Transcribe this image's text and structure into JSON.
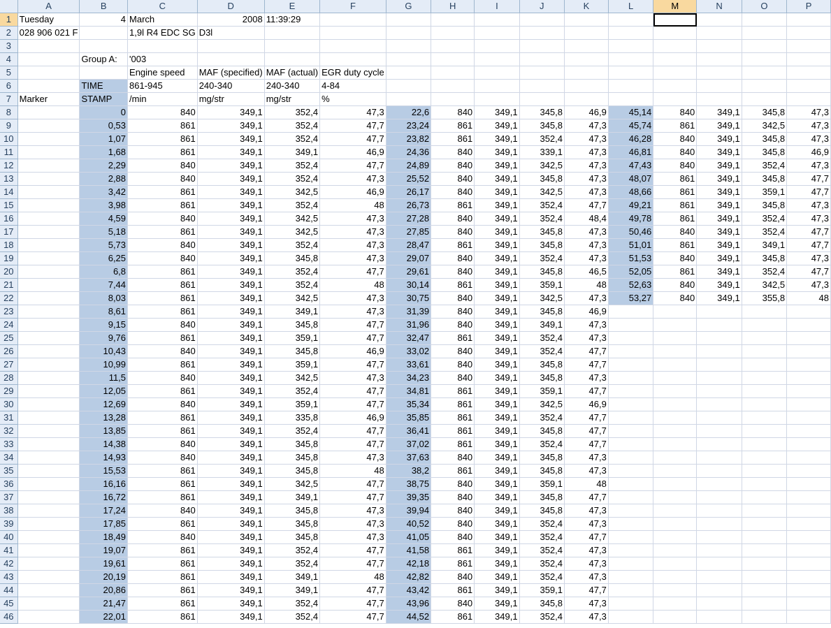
{
  "columns": [
    "A",
    "B",
    "C",
    "D",
    "E",
    "F",
    "G",
    "H",
    "I",
    "J",
    "K",
    "L",
    "M",
    "N",
    "O",
    "P"
  ],
  "selected_column": "M",
  "selected_row": 1,
  "header_rows": [
    [
      "Tuesday",
      "4",
      "March",
      "2008",
      "11:39:29",
      "",
      "",
      "",
      "",
      "",
      "",
      "",
      "",
      "",
      "",
      ""
    ],
    [
      "028 906 021 F",
      "",
      "1,9l R4 EDC SG",
      "D3l",
      "",
      "",
      "",
      "",
      "",
      "",
      "",
      "",
      "",
      "",
      "",
      ""
    ],
    [
      "",
      "",
      "",
      "",
      "",
      "",
      "",
      "",
      "",
      "",
      "",
      "",
      "",
      "",
      "",
      ""
    ],
    [
      "",
      "Group A:",
      "'003",
      "",
      "",
      "",
      "",
      "",
      "",
      "",
      "",
      "",
      "",
      "",
      "",
      ""
    ],
    [
      "",
      "",
      "Engine speed",
      "MAF (specified)",
      "MAF (actual)",
      "EGR duty cycle",
      "",
      "",
      "",
      "",
      "",
      "",
      "",
      "",
      "",
      ""
    ],
    [
      "",
      "TIME",
      "861-945",
      "240-340",
      "240-340",
      "4-84",
      "",
      "",
      "",
      "",
      "",
      "",
      "",
      "",
      "",
      ""
    ],
    [
      "Marker",
      "STAMP",
      " /min",
      "mg/str",
      "mg/str",
      "%",
      "",
      "",
      "",
      "",
      "",
      "",
      "",
      "",
      "",
      ""
    ]
  ],
  "data_rows": [
    [
      "0",
      "840",
      "349,1",
      "352,4",
      "47,3",
      "22,6",
      "840",
      "349,1",
      "345,8",
      "46,9",
      "45,14",
      "840",
      "349,1",
      "345,8",
      "47,3"
    ],
    [
      "0,53",
      "861",
      "349,1",
      "352,4",
      "47,7",
      "23,24",
      "861",
      "349,1",
      "345,8",
      "47,3",
      "45,74",
      "861",
      "349,1",
      "342,5",
      "47,3"
    ],
    [
      "1,07",
      "861",
      "349,1",
      "352,4",
      "47,7",
      "23,82",
      "861",
      "349,1",
      "352,4",
      "47,3",
      "46,28",
      "840",
      "349,1",
      "345,8",
      "47,3"
    ],
    [
      "1,68",
      "861",
      "349,1",
      "349,1",
      "46,9",
      "24,36",
      "840",
      "349,1",
      "339,1",
      "47,3",
      "46,81",
      "840",
      "349,1",
      "345,8",
      "46,9"
    ],
    [
      "2,29",
      "840",
      "349,1",
      "352,4",
      "47,7",
      "24,89",
      "840",
      "349,1",
      "342,5",
      "47,3",
      "47,43",
      "840",
      "349,1",
      "352,4",
      "47,3"
    ],
    [
      "2,88",
      "840",
      "349,1",
      "352,4",
      "47,3",
      "25,52",
      "840",
      "349,1",
      "345,8",
      "47,3",
      "48,07",
      "861",
      "349,1",
      "345,8",
      "47,7"
    ],
    [
      "3,42",
      "861",
      "349,1",
      "342,5",
      "46,9",
      "26,17",
      "840",
      "349,1",
      "342,5",
      "47,3",
      "48,66",
      "861",
      "349,1",
      "359,1",
      "47,7"
    ],
    [
      "3,98",
      "861",
      "349,1",
      "352,4",
      "48",
      "26,73",
      "861",
      "349,1",
      "352,4",
      "47,7",
      "49,21",
      "861",
      "349,1",
      "345,8",
      "47,3"
    ],
    [
      "4,59",
      "840",
      "349,1",
      "342,5",
      "47,3",
      "27,28",
      "840",
      "349,1",
      "352,4",
      "48,4",
      "49,78",
      "861",
      "349,1",
      "352,4",
      "47,3"
    ],
    [
      "5,18",
      "861",
      "349,1",
      "342,5",
      "47,3",
      "27,85",
      "840",
      "349,1",
      "345,8",
      "47,3",
      "50,46",
      "840",
      "349,1",
      "352,4",
      "47,7"
    ],
    [
      "5,73",
      "840",
      "349,1",
      "352,4",
      "47,3",
      "28,47",
      "861",
      "349,1",
      "345,8",
      "47,3",
      "51,01",
      "861",
      "349,1",
      "349,1",
      "47,7"
    ],
    [
      "6,25",
      "840",
      "349,1",
      "345,8",
      "47,3",
      "29,07",
      "840",
      "349,1",
      "352,4",
      "47,3",
      "51,53",
      "840",
      "349,1",
      "345,8",
      "47,3"
    ],
    [
      "6,8",
      "861",
      "349,1",
      "352,4",
      "47,7",
      "29,61",
      "840",
      "349,1",
      "345,8",
      "46,5",
      "52,05",
      "861",
      "349,1",
      "352,4",
      "47,7"
    ],
    [
      "7,44",
      "861",
      "349,1",
      "352,4",
      "48",
      "30,14",
      "861",
      "349,1",
      "359,1",
      "48",
      "52,63",
      "840",
      "349,1",
      "342,5",
      "47,3"
    ],
    [
      "8,03",
      "861",
      "349,1",
      "342,5",
      "47,3",
      "30,75",
      "840",
      "349,1",
      "342,5",
      "47,3",
      "53,27",
      "840",
      "349,1",
      "355,8",
      "48"
    ],
    [
      "8,61",
      "861",
      "349,1",
      "349,1",
      "47,3",
      "31,39",
      "840",
      "349,1",
      "345,8",
      "46,9",
      "",
      "",
      "",
      "",
      ""
    ],
    [
      "9,15",
      "840",
      "349,1",
      "345,8",
      "47,7",
      "31,96",
      "840",
      "349,1",
      "349,1",
      "47,3",
      "",
      "",
      "",
      "",
      ""
    ],
    [
      "9,76",
      "861",
      "349,1",
      "359,1",
      "47,7",
      "32,47",
      "861",
      "349,1",
      "352,4",
      "47,3",
      "",
      "",
      "",
      "",
      ""
    ],
    [
      "10,43",
      "840",
      "349,1",
      "345,8",
      "46,9",
      "33,02",
      "840",
      "349,1",
      "352,4",
      "47,7",
      "",
      "",
      "",
      "",
      ""
    ],
    [
      "10,99",
      "861",
      "349,1",
      "359,1",
      "47,7",
      "33,61",
      "840",
      "349,1",
      "345,8",
      "47,7",
      "",
      "",
      "",
      "",
      ""
    ],
    [
      "11,5",
      "840",
      "349,1",
      "342,5",
      "47,3",
      "34,23",
      "840",
      "349,1",
      "345,8",
      "47,3",
      "",
      "",
      "",
      "",
      ""
    ],
    [
      "12,05",
      "861",
      "349,1",
      "352,4",
      "47,7",
      "34,81",
      "861",
      "349,1",
      "359,1",
      "47,7",
      "",
      "",
      "",
      "",
      ""
    ],
    [
      "12,69",
      "840",
      "349,1",
      "359,1",
      "47,7",
      "35,34",
      "861",
      "349,1",
      "342,5",
      "46,9",
      "",
      "",
      "",
      "",
      ""
    ],
    [
      "13,28",
      "861",
      "349,1",
      "335,8",
      "46,9",
      "35,85",
      "861",
      "349,1",
      "352,4",
      "47,7",
      "",
      "",
      "",
      "",
      ""
    ],
    [
      "13,85",
      "861",
      "349,1",
      "352,4",
      "47,7",
      "36,41",
      "861",
      "349,1",
      "345,8",
      "47,7",
      "",
      "",
      "",
      "",
      ""
    ],
    [
      "14,38",
      "840",
      "349,1",
      "345,8",
      "47,7",
      "37,02",
      "861",
      "349,1",
      "352,4",
      "47,7",
      "",
      "",
      "",
      "",
      ""
    ],
    [
      "14,93",
      "840",
      "349,1",
      "345,8",
      "47,3",
      "37,63",
      "840",
      "349,1",
      "345,8",
      "47,3",
      "",
      "",
      "",
      "",
      ""
    ],
    [
      "15,53",
      "861",
      "349,1",
      "345,8",
      "48",
      "38,2",
      "861",
      "349,1",
      "345,8",
      "47,3",
      "",
      "",
      "",
      "",
      ""
    ],
    [
      "16,16",
      "861",
      "349,1",
      "342,5",
      "47,7",
      "38,75",
      "840",
      "349,1",
      "359,1",
      "48",
      "",
      "",
      "",
      "",
      ""
    ],
    [
      "16,72",
      "861",
      "349,1",
      "349,1",
      "47,7",
      "39,35",
      "840",
      "349,1",
      "345,8",
      "47,7",
      "",
      "",
      "",
      "",
      ""
    ],
    [
      "17,24",
      "840",
      "349,1",
      "345,8",
      "47,3",
      "39,94",
      "840",
      "349,1",
      "345,8",
      "47,3",
      "",
      "",
      "",
      "",
      ""
    ],
    [
      "17,85",
      "861",
      "349,1",
      "345,8",
      "47,3",
      "40,52",
      "840",
      "349,1",
      "352,4",
      "47,3",
      "",
      "",
      "",
      "",
      ""
    ],
    [
      "18,49",
      "840",
      "349,1",
      "345,8",
      "47,3",
      "41,05",
      "840",
      "349,1",
      "352,4",
      "47,7",
      "",
      "",
      "",
      "",
      ""
    ],
    [
      "19,07",
      "861",
      "349,1",
      "352,4",
      "47,7",
      "41,58",
      "861",
      "349,1",
      "352,4",
      "47,3",
      "",
      "",
      "",
      "",
      ""
    ],
    [
      "19,61",
      "861",
      "349,1",
      "352,4",
      "47,7",
      "42,18",
      "861",
      "349,1",
      "352,4",
      "47,3",
      "",
      "",
      "",
      "",
      ""
    ],
    [
      "20,19",
      "861",
      "349,1",
      "349,1",
      "48",
      "42,82",
      "840",
      "349,1",
      "352,4",
      "47,3",
      "",
      "",
      "",
      "",
      ""
    ],
    [
      "20,86",
      "861",
      "349,1",
      "349,1",
      "47,7",
      "43,42",
      "861",
      "349,1",
      "359,1",
      "47,7",
      "",
      "",
      "",
      "",
      ""
    ],
    [
      "21,47",
      "861",
      "349,1",
      "352,4",
      "47,7",
      "43,96",
      "840",
      "349,1",
      "345,8",
      "47,3",
      "",
      "",
      "",
      "",
      ""
    ],
    [
      "22,01",
      "861",
      "349,1",
      "352,4",
      "47,7",
      "44,52",
      "861",
      "349,1",
      "352,4",
      "47,3",
      "",
      "",
      "",
      "",
      ""
    ]
  ],
  "colors": {
    "header_bg": "#e4ecf7",
    "selected_header_bg": "#f9d99f",
    "highlight_bg": "#b8cce4",
    "gridline": "#d0d7e5"
  }
}
